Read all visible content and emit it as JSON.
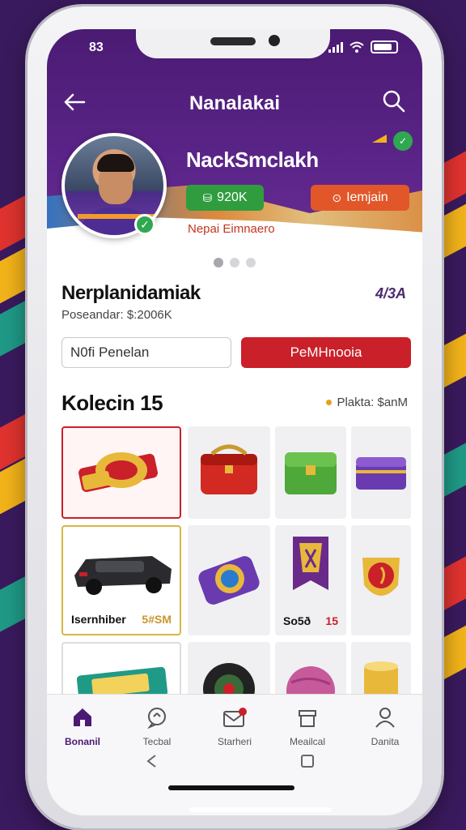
{
  "status": {
    "time": "83"
  },
  "header": {
    "title": "Nanalakai"
  },
  "profile": {
    "name": "NackSmclakh",
    "green_pill": "920K",
    "orange_pill": "Iemjain",
    "subtitle": "Nepai Eimnaero"
  },
  "section1": {
    "title": "Nerplanidamiak",
    "right_value": "4/3A",
    "subtitle": "Poseandar: $:2006K",
    "input_value": "N0fi Penelan",
    "cta_label": "PeMHnooia"
  },
  "collection": {
    "title": "Kolecin 15",
    "filter_label": "Plakta: $anM",
    "items": [
      {
        "name": "",
        "value": ""
      },
      {
        "name": "",
        "value": ""
      },
      {
        "name": "",
        "value": ""
      },
      {
        "name": "",
        "value": ""
      },
      {
        "name": "Isernhiber",
        "value": "5#SM"
      },
      {
        "name": "",
        "value": ""
      },
      {
        "name": "So5ð",
        "value": "15"
      },
      {
        "name": "",
        "value": ""
      }
    ]
  },
  "tabs": [
    {
      "label": "Bonanil",
      "icon": "home-icon"
    },
    {
      "label": "Tecbal",
      "icon": "chat-icon"
    },
    {
      "label": "Starheri",
      "icon": "mail-icon"
    },
    {
      "label": "Meailcal",
      "icon": "store-icon"
    },
    {
      "label": "Danita",
      "icon": "user-icon"
    }
  ],
  "colors": {
    "header": "#4b1b73",
    "accent_red": "#c9202a",
    "accent_green": "#2f9d3e",
    "accent_orange": "#e2572a",
    "gold": "#d6b545"
  }
}
